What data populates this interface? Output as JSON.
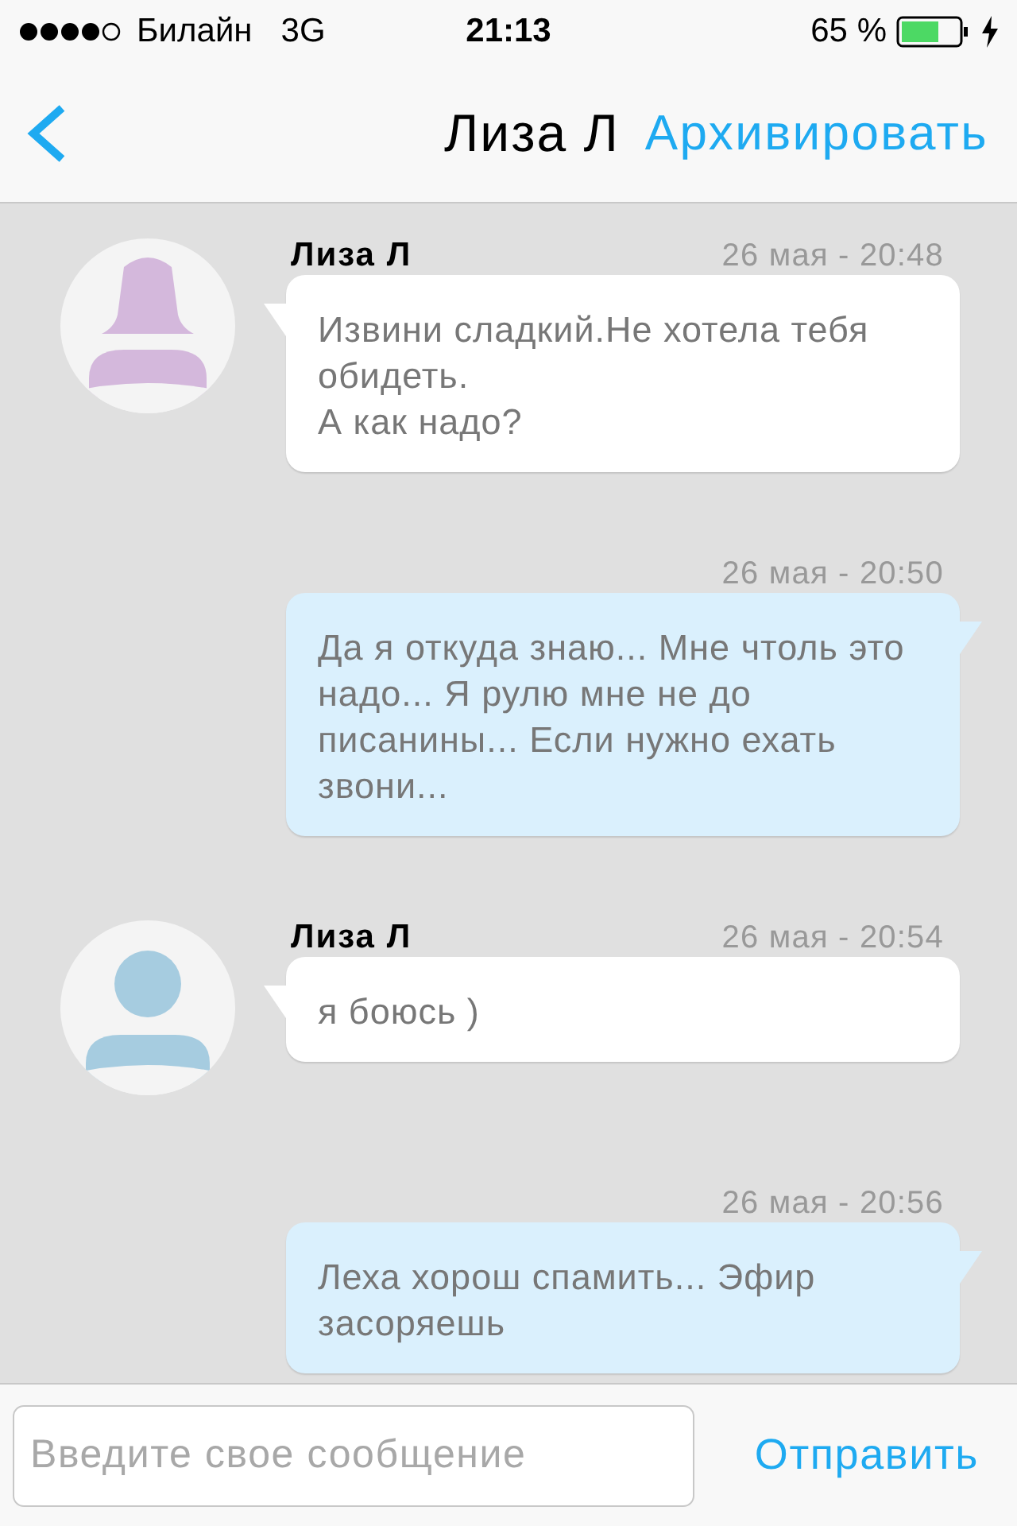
{
  "status_bar": {
    "carrier": "Билайн",
    "network": "3G",
    "time": "21:13",
    "battery": "65 %"
  },
  "nav": {
    "title": "Лиза Л",
    "action": "Архивировать"
  },
  "messages": [
    {
      "kind": "incoming",
      "author": "Лиза Л",
      "time": "26 мая - 20:48",
      "text": "Извини сладкий.Не хотела тебя обидеть.\nА как надо?",
      "avatar": {
        "kind": "female",
        "color": "#d4b8dc"
      }
    },
    {
      "kind": "outgoing",
      "time": "26 мая - 20:50",
      "text": "Да я откуда знаю... Мне чтоль это надо... Я рулю мне не до писанины... Если нужно ехать звони..."
    },
    {
      "kind": "incoming",
      "author": "Лиза Л",
      "time": "26 мая - 20:54",
      "text": "я боюсь )",
      "avatar": {
        "kind": "male",
        "color": "#a6cce0"
      }
    },
    {
      "kind": "outgoing",
      "time": "26 мая - 20:56",
      "text": "Леха хорош спамить... Эфир засоряешь"
    }
  ],
  "composer": {
    "placeholder": "Введите свое сообщение",
    "send": "Отправить"
  }
}
